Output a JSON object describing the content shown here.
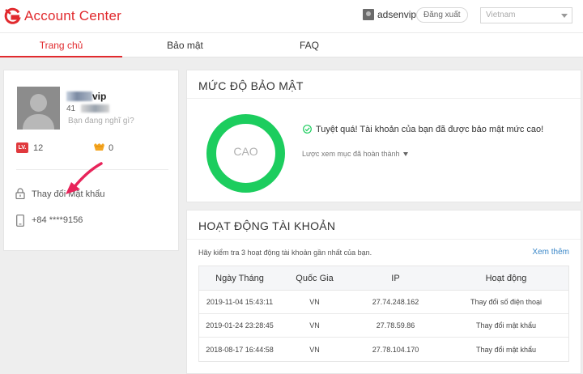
{
  "header": {
    "brand": "Account Center",
    "username": "adsenvip",
    "logout_label": "Đăng xuất",
    "language": "Vietnam"
  },
  "nav": {
    "tabs": [
      {
        "label": "Trang chủ",
        "active": true
      },
      {
        "label": "Bảo mật",
        "active": false
      },
      {
        "label": "FAQ",
        "active": false
      }
    ]
  },
  "profile": {
    "name_visible": "vip",
    "id_visible": "41",
    "status_placeholder": "Bạn đang nghĩ gì?",
    "level_badge": "LV.",
    "level": "12",
    "coins": "0",
    "change_password": "Thay đổi Mật khẩu",
    "phone": "+84 ****9156"
  },
  "security": {
    "title": "MỨC ĐỘ BẢO MẬT",
    "level_label": "CAO",
    "message": "Tuyệt quá! Tài khoản của bạn đã được bảo mật mức cao!",
    "more_label": "Lược xem mục đã hoàn thành"
  },
  "activity": {
    "title": "HOẠT ĐỘNG TÀI KHOẢN",
    "hint": "Hãy kiểm tra 3 hoạt động tài khoản gần nhất của bạn.",
    "more_label": "Xem thêm",
    "columns": [
      "Ngày Tháng",
      "Quốc Gia",
      "IP",
      "Hoạt động"
    ],
    "rows": [
      [
        "2019-11-04 15:43:11",
        "VN",
        "27.74.248.162",
        "Thay đổi số điện thoại"
      ],
      [
        "2019-01-24 23:28:45",
        "VN",
        "27.78.59.86",
        "Thay đổi mật khẩu"
      ],
      [
        "2018-08-17 16:44:58",
        "VN",
        "27.78.104.170",
        "Thay đổi mật khẩu"
      ]
    ]
  },
  "colors": {
    "brand_red": "#e12a2e",
    "security_green": "#1ccd5e",
    "link_blue": "#3a87c8"
  }
}
